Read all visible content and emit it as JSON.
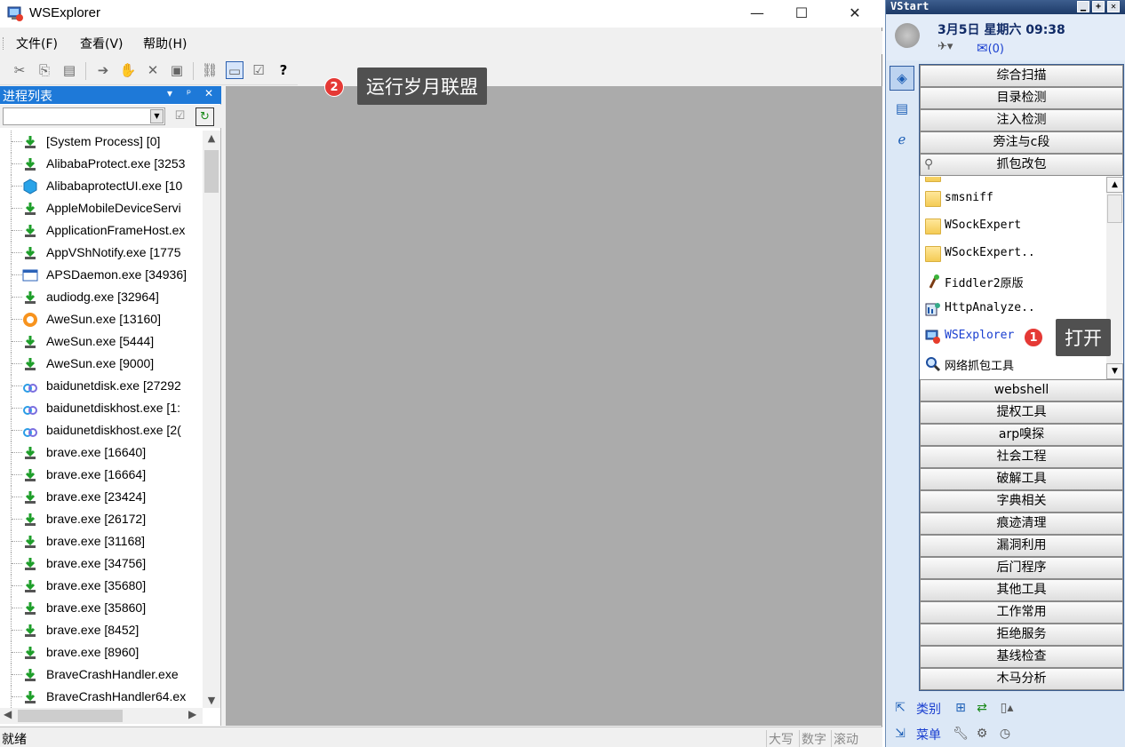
{
  "wsexplorer": {
    "title": "WSExplorer",
    "controls": {
      "minimize": "—",
      "maximize": "☐",
      "close": "✕"
    },
    "menu": [
      "文件(F)",
      "查看(V)",
      "帮助(H)"
    ],
    "toolbar_icons": [
      "cut-icon",
      "copy-icon",
      "paste-icon",
      "forward-icon",
      "hand-icon",
      "delete-icon",
      "save-icon",
      "network-icon",
      "window-icon",
      "properties-icon",
      "help-icon"
    ],
    "process_panel": {
      "title": "进程列表",
      "header_buttons": [
        "▾",
        "ᵖ",
        "✕"
      ],
      "filter_value": "",
      "processes": [
        {
          "name": "[System Process] [0]",
          "icon": "download-green"
        },
        {
          "name": "AlibabaProtect.exe [3253",
          "icon": "download-green"
        },
        {
          "name": "AlibabaprotectUI.exe [10",
          "icon": "hex-blue"
        },
        {
          "name": "AppleMobileDeviceServi",
          "icon": "download-green"
        },
        {
          "name": "ApplicationFrameHost.ex",
          "icon": "download-green"
        },
        {
          "name": "AppVShNotify.exe [1775",
          "icon": "download-green"
        },
        {
          "name": "APSDaemon.exe [34936]",
          "icon": "window-blue"
        },
        {
          "name": "audiodg.exe [32964]",
          "icon": "download-green"
        },
        {
          "name": "AweSun.exe [13160]",
          "icon": "orange-circle"
        },
        {
          "name": "AweSun.exe [5444]",
          "icon": "download-green"
        },
        {
          "name": "AweSun.exe [9000]",
          "icon": "download-green"
        },
        {
          "name": "baidunetdisk.exe [27292",
          "icon": "cloud"
        },
        {
          "name": "baidunetdiskhost.exe [1:",
          "icon": "cloud"
        },
        {
          "name": "baidunetdiskhost.exe [2(",
          "icon": "cloud"
        },
        {
          "name": "brave.exe [16640]",
          "icon": "download-green"
        },
        {
          "name": "brave.exe [16664]",
          "icon": "download-green"
        },
        {
          "name": "brave.exe [23424]",
          "icon": "download-green"
        },
        {
          "name": "brave.exe [26172]",
          "icon": "download-green"
        },
        {
          "name": "brave.exe [31168]",
          "icon": "download-green"
        },
        {
          "name": "brave.exe [34756]",
          "icon": "download-green"
        },
        {
          "name": "brave.exe [35680]",
          "icon": "download-green"
        },
        {
          "name": "brave.exe [35860]",
          "icon": "download-green"
        },
        {
          "name": "brave.exe [8452]",
          "icon": "download-green"
        },
        {
          "name": "brave.exe [8960]",
          "icon": "download-green"
        },
        {
          "name": "BraveCrashHandler.exe",
          "icon": "download-green"
        },
        {
          "name": "BraveCrashHandler64.ex",
          "icon": "download-green"
        }
      ]
    },
    "status": {
      "left": "就绪",
      "indicators": [
        "大写",
        "数字",
        "滚动"
      ]
    }
  },
  "callouts": {
    "run": {
      "badge": "2",
      "text": "运行岁月联盟"
    },
    "open": {
      "badge": "1",
      "text": "打开"
    }
  },
  "vstart": {
    "title": "VStart",
    "window_buttons": [
      "▁",
      "+",
      "✕"
    ],
    "date": "3月5日  星期六  09:38",
    "mail": "(0)",
    "categories_top": [
      "综合扫描",
      "目录检测",
      "注入检测",
      "旁注与c段",
      "抓包改包"
    ],
    "items": [
      {
        "name": "smsniff",
        "icon": "folder"
      },
      {
        "name": "WSockExpert",
        "icon": "folder"
      },
      {
        "name": "WSockExpert..",
        "icon": "folder"
      },
      {
        "name": "Fiddler2原版",
        "icon": "fiddler"
      },
      {
        "name": "HttpAnalyze..",
        "icon": "httpanalyzer"
      },
      {
        "name": "WSExplorer ..",
        "icon": "wsexplorer"
      },
      {
        "name": "网络抓包工具",
        "icon": "magnifier"
      }
    ],
    "categories_bottom": [
      "webshell",
      "提权工具",
      "arp嗅探",
      "社会工程",
      "破解工具",
      "字典相关",
      "痕迹清理",
      "漏洞利用",
      "后门程序",
      "其他工具",
      "工作常用",
      "拒绝服务",
      "基线检查",
      "木马分析"
    ],
    "bottom": {
      "category_label": "类别",
      "menu_label": "菜单"
    }
  }
}
